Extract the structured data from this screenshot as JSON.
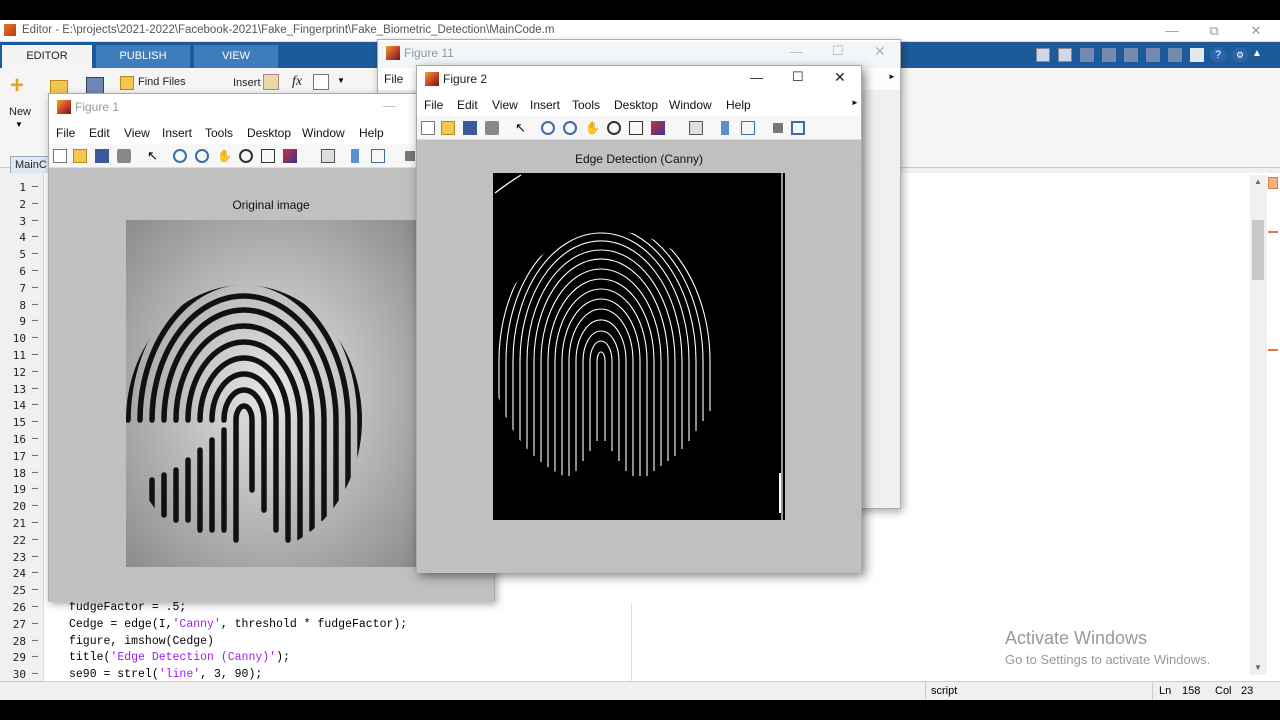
{
  "editor": {
    "title": "Editor - E:\\projects\\2021-2022\\Facebook-2021\\Fake_Fingerprint\\Fake_Biometric_Detection\\MainCode.m",
    "tabs": [
      "EDITOR",
      "PUBLISH",
      "VIEW"
    ],
    "ribbon": {
      "new_label": "New",
      "find_files": "Find Files",
      "insert_label": "Insert",
      "fx": "fx"
    },
    "doc_tab": "MainC",
    "line_numbers": [
      "1",
      "2",
      "3",
      "4",
      "5",
      "6",
      "7",
      "8",
      "9",
      "10",
      "11",
      "12",
      "13",
      "14",
      "15",
      "16",
      "17",
      "18",
      "19",
      "20",
      "21",
      "22",
      "23",
      "24",
      "25",
      "26",
      "27",
      "28",
      "29",
      "30"
    ],
    "code_lines": [
      {
        "n": "26",
        "parts": [
          "fudgeFactor = .5;"
        ]
      },
      {
        "n": "27",
        "a": "Cedge = edge(I,",
        "s": "'Canny'",
        "b": ", threshold * fudgeFactor);"
      },
      {
        "n": "28",
        "a": "figure, imshow(Cedge)",
        "s": "",
        "b": ""
      },
      {
        "n": "29",
        "a": "title(",
        "s": "'Edge Detection (Canny)'",
        "b": ");"
      },
      {
        "n": "30",
        "a": "se90 = strel(",
        "s": "'line'",
        "b": ", 3, 90);"
      }
    ],
    "status": {
      "mode": "script",
      "ln_label": "Ln",
      "ln": "158",
      "col_label": "Col",
      "col": "23"
    },
    "activate": {
      "title": "Activate Windows",
      "sub": "Go to Settings to activate Windows."
    }
  },
  "figure11": {
    "title": "Figure 11",
    "menu_file": "File"
  },
  "figure1": {
    "title": "Figure 1",
    "menu": [
      "File",
      "Edit",
      "View",
      "Insert",
      "Tools",
      "Desktop",
      "Window",
      "Help"
    ],
    "axes_title": "Original image"
  },
  "figure2": {
    "title": "Figure 2",
    "menu": [
      "File",
      "Edit",
      "View",
      "Insert",
      "Tools",
      "Desktop",
      "Window",
      "Help"
    ],
    "axes_title": "Edge Detection (Canny)"
  },
  "colors": {
    "ribbon_blue": "#1d5a99",
    "tab_blue": "#3f7cbd",
    "string_purple": "#a020f0",
    "figure_bg": "#c0c0c0"
  }
}
